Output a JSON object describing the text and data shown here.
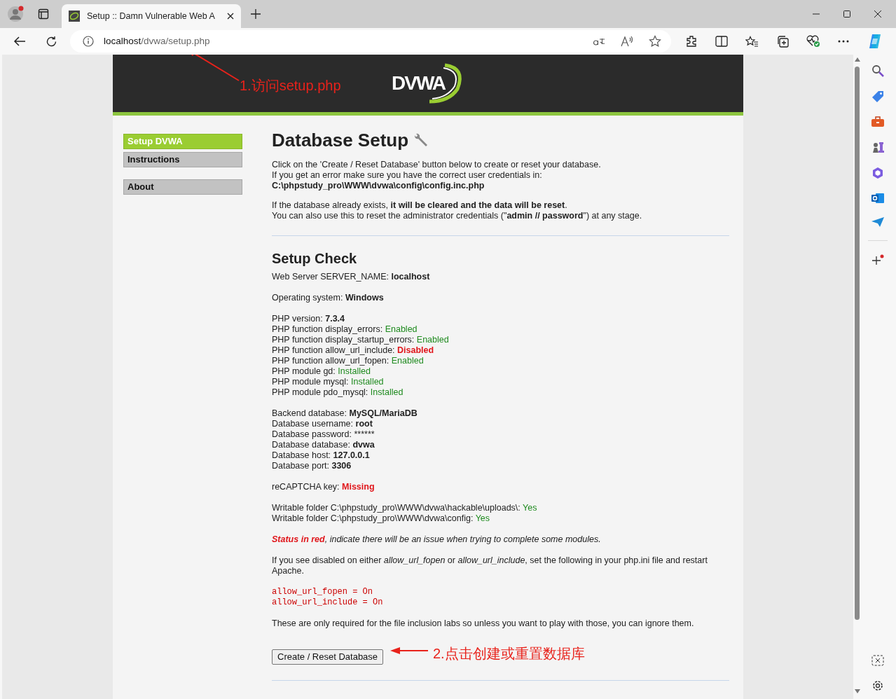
{
  "browser": {
    "tab_title": "Setup :: Damn Vulnerable Web A",
    "address": {
      "host": "localhost",
      "path": "/dvwa/setup.php"
    }
  },
  "logo": "DVWA",
  "nav": [
    {
      "label": "Setup DVWA",
      "selected": true
    },
    {
      "label": "Instructions",
      "selected": false
    },
    {
      "label": "About",
      "selected": false
    }
  ],
  "heading": "Database Setup",
  "intro": [
    [
      "Click on the 'Create / Reset Database' button below to create or reset your database.",
      "If you get an error make sure you have the correct user credentials in:",
      "**C:\\phpstudy_pro\\WWW\\dvwa\\config\\config.inc.php**"
    ],
    [
      "If the database already exists, **it will be cleared and the data will be reset**.",
      "You can also use this to reset the administrator credentials (\"**admin // password**\") at any stage."
    ]
  ],
  "setup_check": {
    "title": "Setup Check",
    "groups": [
      [
        {
          "kind": "check",
          "label": "Web Server SERVER_NAME: ",
          "value": "localhost",
          "bold": true
        }
      ],
      [
        {
          "kind": "check",
          "label": "Operating system: ",
          "value": "Windows",
          "bold": true
        }
      ],
      [
        {
          "kind": "check",
          "label": "PHP version: ",
          "value": "7.3.4",
          "bold": true
        },
        {
          "kind": "check",
          "label": "PHP function display_errors: ",
          "value": "Enabled",
          "bold": false,
          "color": "#1e8a1e"
        },
        {
          "kind": "check",
          "label": "PHP function display_startup_errors: ",
          "value": "Enabled",
          "bold": false,
          "color": "#1e8a1e"
        },
        {
          "kind": "check",
          "label": "PHP function allow_url_include: ",
          "value": "Disabled",
          "bold": true,
          "color": "#e0161b"
        },
        {
          "kind": "check",
          "label": "PHP function allow_url_fopen: ",
          "value": "Enabled",
          "bold": false,
          "color": "#1e8a1e"
        },
        {
          "kind": "check",
          "label": "PHP module gd: ",
          "value": "Installed",
          "bold": false,
          "color": "#1e8a1e"
        },
        {
          "kind": "check",
          "label": "PHP module mysql: ",
          "value": "Installed",
          "bold": false,
          "color": "#1e8a1e"
        },
        {
          "kind": "check",
          "label": "PHP module pdo_mysql: ",
          "value": "Installed",
          "bold": false,
          "color": "#1e8a1e"
        }
      ],
      [
        {
          "kind": "check",
          "label": "Backend database: ",
          "value": "MySQL/MariaDB",
          "bold": true
        },
        {
          "kind": "check",
          "label": "Database username: ",
          "value": "root",
          "bold": true
        },
        {
          "kind": "check",
          "label": "Database password: ",
          "value": "******",
          "bold": false
        },
        {
          "kind": "check",
          "label": "Database database: ",
          "value": "dvwa",
          "bold": true
        },
        {
          "kind": "check",
          "label": "Database host: ",
          "value": "127.0.0.1",
          "bold": true
        },
        {
          "kind": "check",
          "label": "Database port: ",
          "value": "3306",
          "bold": true
        }
      ],
      [
        {
          "kind": "check",
          "label": "reCAPTCHA key: ",
          "value": "Missing",
          "bold": true,
          "color": "#e0161b"
        }
      ],
      [
        {
          "kind": "check",
          "label": "Writable folder C:\\phpstudy_pro\\WWW\\dvwa\\hackable\\uploads\\: ",
          "value": "Yes",
          "bold": false,
          "color": "#1e8a1e"
        },
        {
          "kind": "check",
          "label": "Writable folder C:\\phpstudy_pro\\WWW\\dvwa\\config: ",
          "value": "Yes",
          "bold": false,
          "color": "#1e8a1e"
        }
      ],
      [
        {
          "kind": "note",
          "emphasis": "Status in red",
          "text": ", indicate there will be an issue when trying to complete some modules."
        }
      ],
      [
        {
          "kind": "text",
          "text": "If you see disabled on either *allow_url_fopen* or *allow_url_include*, set the following in your php.ini file and restart Apache."
        }
      ],
      [
        {
          "kind": "code",
          "text": "allow_url_fopen = On"
        },
        {
          "kind": "code",
          "text": "allow_url_include = On"
        }
      ],
      [
        {
          "kind": "text",
          "text": "These are only required for the file inclusion labs so unless you want to play with those, you can ignore them."
        }
      ]
    ]
  },
  "button": "Create / Reset Database",
  "annotations": [
    "1.访问setup.php",
    "2.点击创建或重置数据库"
  ]
}
